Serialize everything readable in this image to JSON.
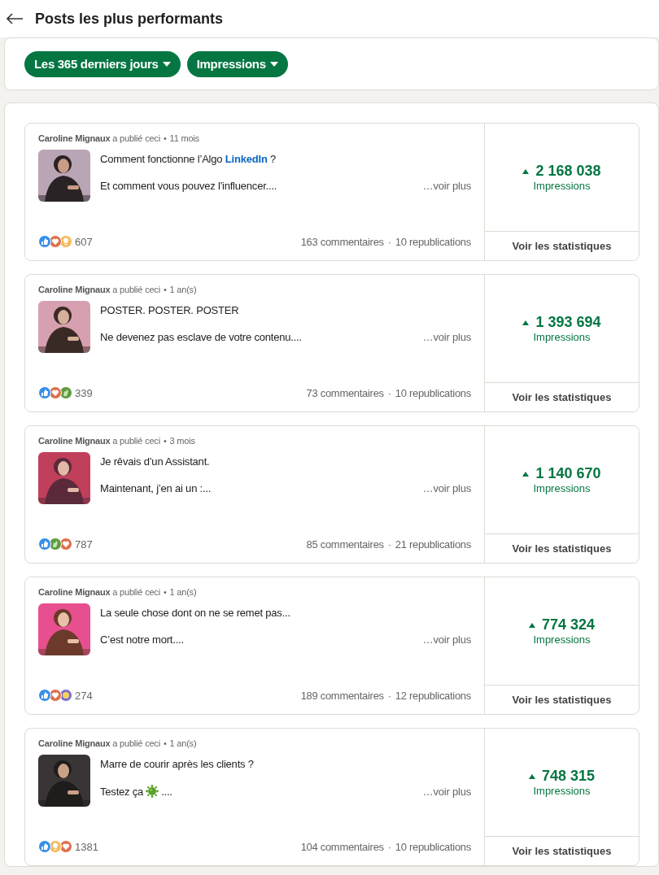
{
  "header": {
    "title": "Posts les plus performants"
  },
  "filters": [
    {
      "label": "Les 365 derniers jours"
    },
    {
      "label": "Impressions"
    }
  ],
  "posts": [
    {
      "author": "Caroline Mignaux",
      "action": "a publié ceci",
      "bullet": "•",
      "age": "11 mois",
      "line1": "Comment fonctionne l’Algo **LinkedIn** ?",
      "line2": "Et comment vous pouvez l'influencer....",
      "more": "…voir plus",
      "reactions": [
        {
          "kind": "like"
        },
        {
          "kind": "love"
        },
        {
          "kind": "insightful"
        }
      ],
      "reaction_count": "607",
      "comments": "163 commentaires",
      "separator": "·",
      "reposts": "10 republications",
      "impressions": "2 168 038",
      "metric": "Impressions",
      "stats_button": "Voir les statistiques"
    },
    {
      "author": "Caroline Mignaux",
      "action": "a publié ceci",
      "bullet": "•",
      "age": "1 an(s)",
      "line1": "POSTER. POSTER. POSTER",
      "line2": "Ne devenez pas esclave de votre contenu....",
      "more": "…voir plus",
      "reactions": [
        {
          "kind": "like"
        },
        {
          "kind": "love"
        },
        {
          "kind": "celebrate"
        }
      ],
      "reaction_count": "339",
      "comments": "73 commentaires",
      "separator": "·",
      "reposts": "10 republications",
      "impressions": "1 393 694",
      "metric": "Impressions",
      "stats_button": "Voir les statistiques"
    },
    {
      "author": "Caroline Mignaux",
      "action": "a publié ceci",
      "bullet": "•",
      "age": "3 mois",
      "line1": "Je rêvais d’un Assistant.",
      "line2": "Maintenant, j’en ai un :...",
      "more": "…voir plus",
      "reactions": [
        {
          "kind": "like"
        },
        {
          "kind": "celebrate"
        },
        {
          "kind": "love"
        }
      ],
      "reaction_count": "787",
      "comments": "85 commentaires",
      "separator": "·",
      "reposts": "21 republications",
      "impressions": "1 140 670",
      "metric": "Impressions",
      "stats_button": "Voir les statistiques"
    },
    {
      "author": "Caroline Mignaux",
      "action": "a publié ceci",
      "bullet": "•",
      "age": "1 an(s)",
      "line1": "La seule chose dont on ne se remet pas...",
      "line2": "C’est notre mort....",
      "more": "…voir plus",
      "reactions": [
        {
          "kind": "like"
        },
        {
          "kind": "love"
        },
        {
          "kind": "funny"
        }
      ],
      "reaction_count": "274",
      "comments": "189 commentaires",
      "separator": "·",
      "reposts": "12 republications",
      "impressions": "774 324",
      "metric": "Impressions",
      "stats_button": "Voir les statistiques"
    },
    {
      "author": "Caroline Mignaux",
      "action": "a publié ceci",
      "bullet": "•",
      "age": "1 an(s)",
      "line1": "Marre de courir après les clients ?",
      "line2": "Testez ça",
      "line2_emoji": true,
      "line2_after": "....",
      "more": "…voir plus",
      "reactions": [
        {
          "kind": "like"
        },
        {
          "kind": "insightful"
        },
        {
          "kind": "love"
        }
      ],
      "reaction_count": "1381",
      "comments": "104 commentaires",
      "separator": "·",
      "reposts": "10 republications",
      "impressions": "748 315",
      "metric": "Impressions",
      "stats_button": "Voir les statistiques"
    }
  ]
}
